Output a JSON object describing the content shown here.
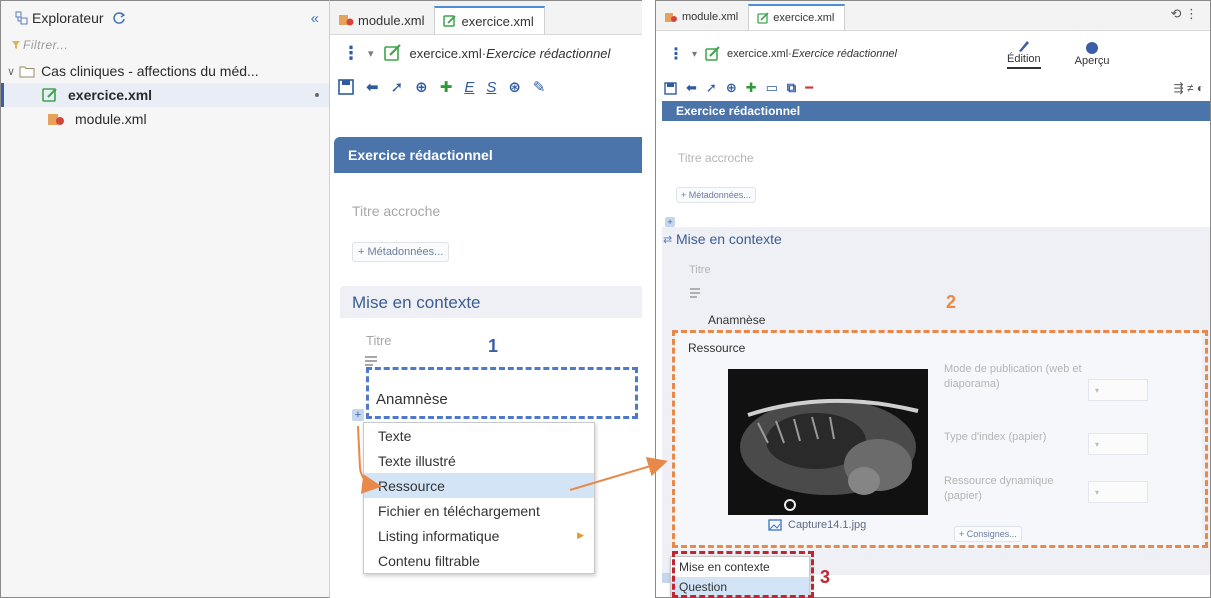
{
  "explorer": {
    "title": "Explorateur",
    "filter_placeholder": "Filtrer...",
    "folder_label": "Cas cliniques - affections du méd...",
    "files": [
      "exercice.xml",
      "module.xml"
    ]
  },
  "editor": {
    "tabs": [
      "module.xml",
      "exercice.xml"
    ],
    "crumb_file": "exercice.xml",
    "crumb_sep": " · ",
    "crumb_kind": "Exercice rédactionnel",
    "crumb_kind_cut": "Exercice rédactionnel",
    "section_title": "Exercice rédactionnel",
    "titre_accroche": "Titre accroche",
    "metadonnees": "+ Métadonnées...",
    "mise_en_contexte": "Mise en contexte",
    "titre": "Titre",
    "anamnese": "Anamnèse",
    "menu": [
      "Texte",
      "Texte illustré",
      "Ressource",
      "Fichier en téléchargement",
      "Listing informatique",
      "Contenu filtrable"
    ],
    "toolbar_letters": [
      "E",
      "S"
    ]
  },
  "editor2": {
    "mode_edition": "Édition",
    "mode_apercu": "Aperçu",
    "ressource": "Ressource",
    "fields": [
      "Mode de publication (web et diaporama)",
      "Type d'index (papier)",
      "Ressource dynamique (papier)"
    ],
    "image_caption": "Capture14.1.jpg",
    "consignes": "+ Consignes...",
    "bottom_menu": [
      "Mise en contexte",
      "Question"
    ]
  },
  "callouts": [
    "1",
    "2",
    "3"
  ],
  "colors": {
    "blue": "#4f7ac9",
    "orange": "#e8894a",
    "red": "#c0262f",
    "header": "#4b74ab"
  }
}
